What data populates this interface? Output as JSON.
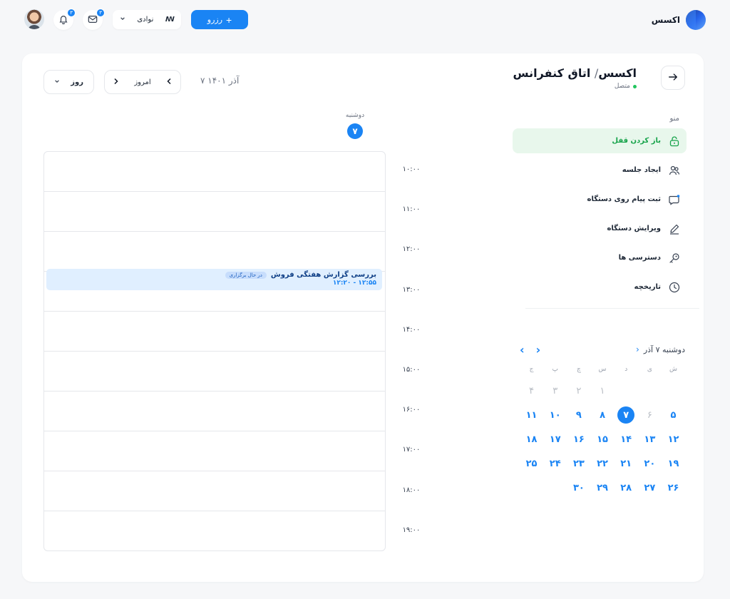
{
  "brand": {
    "name": "اکسس"
  },
  "topbar": {
    "reserve_label": "رزرو",
    "reserve_plus": "+",
    "user_name": "نوادی",
    "user_logo": "ꟿ",
    "mail_count": "۳",
    "notif_count": "۳"
  },
  "header": {
    "title_prefix": "اکسس",
    "title_sep": "/",
    "title_room": "اتاق کنفرانس",
    "status": "متصل"
  },
  "menu": {
    "title": "منو",
    "items": [
      {
        "label": "باز کردن قفل",
        "icon": "unlock-icon"
      },
      {
        "label": "ایجاد جلسه",
        "icon": "users-icon"
      },
      {
        "label": "ثبت پیام روی دستگاه",
        "icon": "message-icon"
      },
      {
        "label": "ویرایش دستگاه",
        "icon": "edit-icon"
      },
      {
        "label": "دسترسی ها",
        "icon": "key-icon"
      },
      {
        "label": "تاریخچه",
        "icon": "clock-icon"
      }
    ]
  },
  "mini_calendar": {
    "title": "دوشنبه ۷ آذر",
    "weekdays": [
      "ش",
      "ی",
      "د",
      "س",
      "چ",
      "پ",
      "ج"
    ],
    "days": [
      {
        "t": "",
        "m": true
      },
      {
        "t": "",
        "m": true
      },
      {
        "t": "",
        "m": true
      },
      {
        "t": "۱",
        "m": true
      },
      {
        "t": "۲",
        "m": true
      },
      {
        "t": "۳",
        "m": true
      },
      {
        "t": "۴",
        "m": true
      },
      {
        "t": "۵"
      },
      {
        "t": "۶",
        "m": true
      },
      {
        "t": "۷",
        "s": true
      },
      {
        "t": "۸"
      },
      {
        "t": "۹"
      },
      {
        "t": "۱۰"
      },
      {
        "t": "۱۱"
      },
      {
        "t": "۱۲"
      },
      {
        "t": "۱۳"
      },
      {
        "t": "۱۴"
      },
      {
        "t": "۱۵"
      },
      {
        "t": "۱۶"
      },
      {
        "t": "۱۷"
      },
      {
        "t": "۱۸"
      },
      {
        "t": "۱۹"
      },
      {
        "t": "۲۰"
      },
      {
        "t": "۲۱"
      },
      {
        "t": "۲۲"
      },
      {
        "t": "۲۳"
      },
      {
        "t": "۲۴"
      },
      {
        "t": "۲۵"
      },
      {
        "t": "۲۶"
      },
      {
        "t": "۲۷"
      },
      {
        "t": "۲۸"
      },
      {
        "t": "۲۹"
      },
      {
        "t": "۳۰"
      }
    ]
  },
  "toolbar": {
    "date": "۷ آذر ۱۴۰۱",
    "today": "امروز",
    "view": "روز"
  },
  "day_view": {
    "day_name": "دوشنبه",
    "day_number": "۷",
    "times": [
      "۱۰:۰۰",
      "۱۱:۰۰",
      "۱۲:۰۰",
      "۱۳:۰۰",
      "۱۴:۰۰",
      "۱۵:۰۰",
      "۱۶:۰۰",
      "۱۷:۰۰",
      "۱۸:۰۰",
      "۱۹:۰۰"
    ],
    "event": {
      "title": "بررسی گزارش هفتگی فروش",
      "tag": "در حال برگزاری",
      "time": "۱۲:۵۵ - ۱۲:۲۰"
    }
  },
  "colors": {
    "accent": "#1a84f4",
    "success": "#16a34a",
    "event_bg": "#e0efff"
  }
}
